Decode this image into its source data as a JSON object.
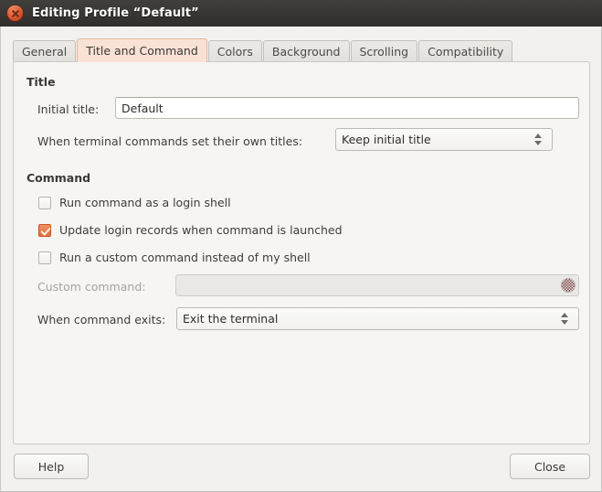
{
  "window": {
    "title": "Editing Profile “Default”",
    "close_icon": "window-close-icon"
  },
  "tabs": [
    {
      "label": "General",
      "selected": false
    },
    {
      "label": "Title and Command",
      "selected": true
    },
    {
      "label": "Colors",
      "selected": false
    },
    {
      "label": "Background",
      "selected": false
    },
    {
      "label": "Scrolling",
      "selected": false
    },
    {
      "label": "Compatibility",
      "selected": false
    }
  ],
  "sections": {
    "title": {
      "heading": "Title",
      "initial_title_label": "Initial title:",
      "initial_title_value": "Default",
      "initial_title_placeholder": "",
      "when_titles_label": "When terminal commands set their own titles:",
      "when_titles_value": "Keep initial title"
    },
    "command": {
      "heading": "Command",
      "login_shell_label": "Run command as a login shell",
      "login_shell_checked": false,
      "update_records_label": "Update login records when command is launched",
      "update_records_checked": true,
      "custom_command_label": "Run a custom command instead of my shell",
      "custom_command_checked": false,
      "custom_command_field_label": "Custom command:",
      "custom_command_field_value": "",
      "custom_command_field_enabled": false,
      "when_exits_label": "When command exits:",
      "when_exits_value": "Exit the terminal"
    }
  },
  "footer": {
    "help_label": "Help",
    "close_label": "Close"
  },
  "colors": {
    "accent": "#e2703c",
    "selected_tab_bg": "#fae1d6",
    "titlebar": "#383733",
    "panel_bg": "#f6f5f4"
  }
}
